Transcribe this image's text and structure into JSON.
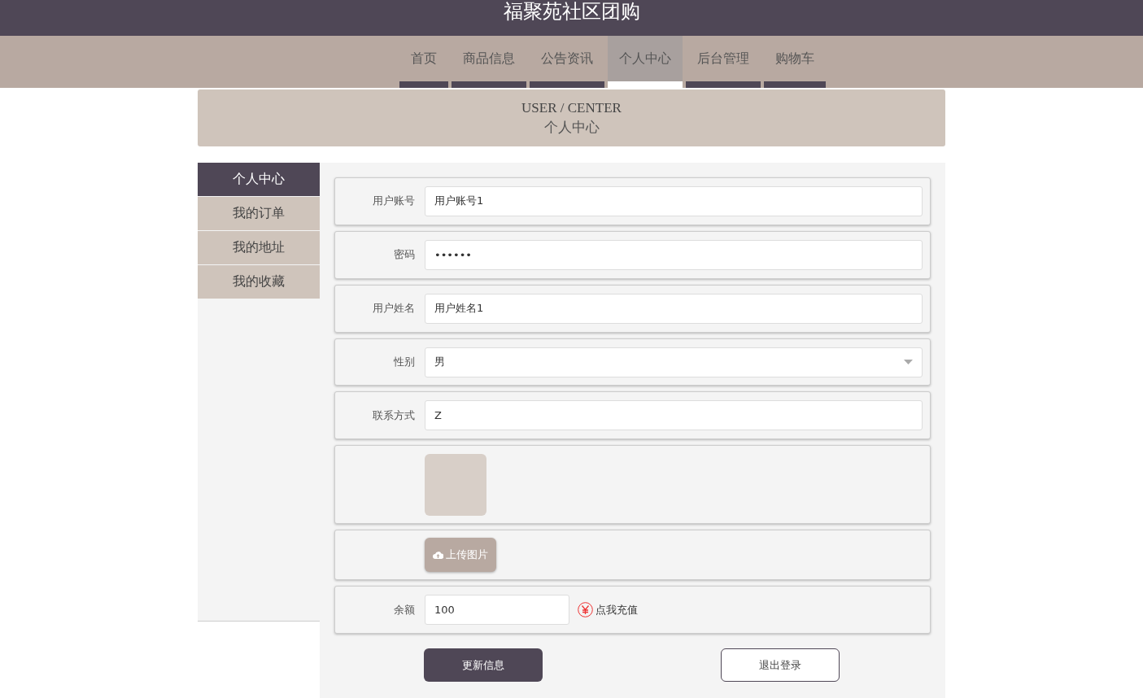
{
  "site_title": "福聚苑社区团购",
  "nav": [
    {
      "label": "首页",
      "selected": false
    },
    {
      "label": "商品信息",
      "selected": false
    },
    {
      "label": "公告资讯",
      "selected": false
    },
    {
      "label": "个人中心",
      "selected": true
    },
    {
      "label": "后台管理",
      "selected": false
    },
    {
      "label": "购物车",
      "selected": false
    }
  ],
  "banner": {
    "title": "USER / CENTER",
    "subtitle": "个人中心"
  },
  "sidebar": {
    "items": [
      {
        "label": "个人中心",
        "selected": true
      },
      {
        "label": "我的订单",
        "selected": false
      },
      {
        "label": "我的地址",
        "selected": false
      },
      {
        "label": "我的收藏",
        "selected": false
      }
    ]
  },
  "form": {
    "rows": [
      {
        "kind": "text",
        "label": "用户账号",
        "value": "用户账号1"
      },
      {
        "kind": "password",
        "label": "密码",
        "value": "••••••"
      },
      {
        "kind": "text",
        "label": "用户姓名",
        "value": "用户姓名1"
      },
      {
        "kind": "select",
        "label": "性别",
        "value": "男"
      },
      {
        "kind": "text",
        "label": "联系方式",
        "value": "Z"
      },
      {
        "kind": "avatar"
      },
      {
        "kind": "upload",
        "button": "上传图片"
      },
      {
        "kind": "balance",
        "label": "余额",
        "value": "100",
        "link": "点我充值"
      }
    ],
    "buttons": [
      {
        "kind": "primary",
        "label": "更新信息"
      },
      {
        "kind": "outline",
        "label": "退出登录"
      }
    ]
  }
}
